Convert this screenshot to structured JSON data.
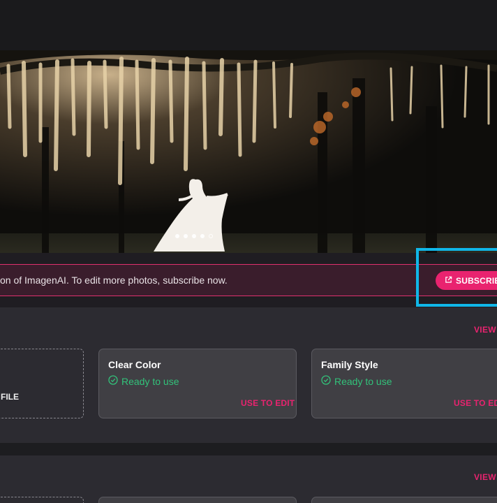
{
  "banner": {
    "text": "on of ImagenAI. To edit more photos, subscribe now.",
    "subscribe_label": "SUBSCRIBE"
  },
  "carousel": {
    "slide_count": 5,
    "active_index": 4
  },
  "section1": {
    "view_all": "VIEW A",
    "upload_label": "FILE",
    "cards": [
      {
        "title": "Clear Color",
        "status": "Ready to use",
        "action": "USE TO EDIT"
      },
      {
        "title": "Family Style",
        "status": "Ready to use",
        "action": "USE TO EDIT"
      }
    ]
  },
  "section2": {
    "view_all": "VIEW A"
  },
  "colors": {
    "accent": "#e9236f",
    "success": "#32c27a",
    "highlight": "#10b7e8",
    "banner_bg": "#3a1d2c",
    "card_bg": "#403f44"
  },
  "icons": {
    "subscribe": "external-link-icon",
    "status": "check-circle-icon"
  }
}
